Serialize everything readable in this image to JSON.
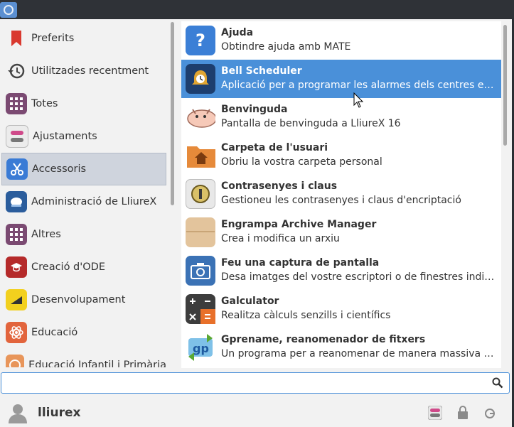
{
  "colors": {
    "accent": "#4a90d9",
    "selected_category_bg": "#cfd4dd"
  },
  "categories": [
    {
      "label": "Preferits",
      "icon": "bookmark-icon"
    },
    {
      "label": "Utilitzades recentment",
      "icon": "history-icon"
    },
    {
      "label": "Totes",
      "icon": "grid-icon"
    },
    {
      "label": "Ajustaments",
      "icon": "toggle-settings-icon"
    },
    {
      "label": "Accessoris",
      "icon": "scissors-icon",
      "selected": true
    },
    {
      "label": "Administració de LliureX",
      "icon": "lliurex-admin-icon"
    },
    {
      "label": "Altres",
      "icon": "grid-icon"
    },
    {
      "label": "Creació d'ODE",
      "icon": "ode-icon"
    },
    {
      "label": "Desenvolupament",
      "icon": "development-icon"
    },
    {
      "label": "Educació",
      "icon": "atom-icon"
    },
    {
      "label": "Educació Infantil i Primària",
      "icon": "education-primary-icon"
    }
  ],
  "apps": [
    {
      "title": "Ajuda",
      "desc": "Obtindre ajuda amb MATE",
      "icon": "help-icon"
    },
    {
      "title": "Bell Scheduler",
      "desc": "Aplicació per a programar les alarmes dels centres ed...",
      "icon": "bell-icon",
      "selected": true
    },
    {
      "title": "Benvinguda",
      "desc": "Pantalla de benvinguda a LliureX 16",
      "icon": "welcome-mascot-icon"
    },
    {
      "title": "Carpeta de l'usuari",
      "desc": "Obriu la vostra carpeta personal",
      "icon": "home-folder-icon"
    },
    {
      "title": "Contrasenyes i claus",
      "desc": "Gestioneu les contrasenyes i claus d'encriptació",
      "icon": "keyring-icon"
    },
    {
      "title": "Engrampa Archive Manager",
      "desc": "Crea i modifica un arxiu",
      "icon": "archive-icon"
    },
    {
      "title": "Feu una captura de pantalla",
      "desc": "Desa imatges del vostre escriptori o de finestres indivi...",
      "icon": "camera-icon"
    },
    {
      "title": "Galculator",
      "desc": "Realitza càlculs senzills i científics",
      "icon": "calculator-icon"
    },
    {
      "title": "Gprename, reanomenador de fitxers",
      "desc": "Un programa per a reanomenar de manera massiva el...",
      "icon": "gprename-icon"
    }
  ],
  "search": {
    "value": "",
    "placeholder": ""
  },
  "user": {
    "name": "lliurex"
  },
  "bottom_buttons": [
    "settings-toggle-icon",
    "lock-icon",
    "logout-icon"
  ]
}
